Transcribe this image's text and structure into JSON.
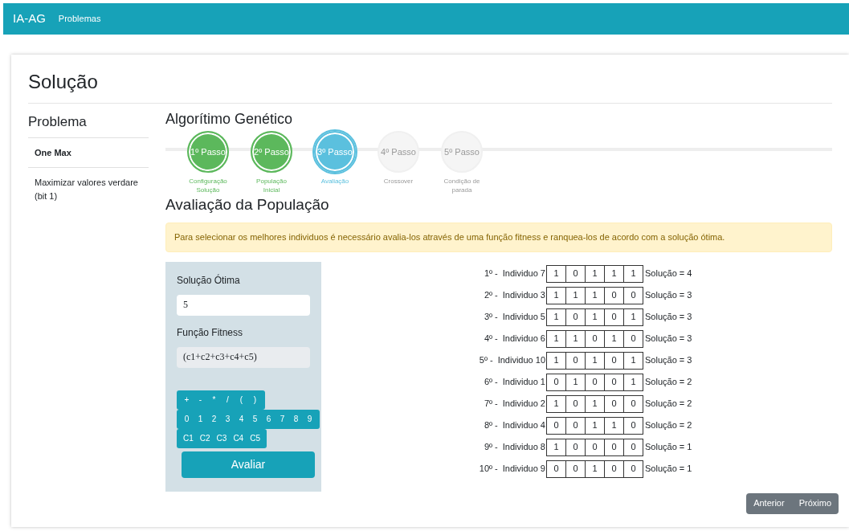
{
  "navbar": {
    "brand": "IA-AG",
    "links": [
      "Problemas"
    ]
  },
  "page_title": "Solução",
  "sidebar": {
    "title": "Problema",
    "items": [
      {
        "label": "One Max",
        "selected": true
      },
      {
        "label": "Maximizar valores verdare (bit 1)",
        "selected": false
      }
    ]
  },
  "section_title": "Algorítimo Genético",
  "steps": [
    {
      "label": "1º Passo",
      "caption": "Configuração Solução",
      "completed": true,
      "selected": false
    },
    {
      "label": "2º Passo",
      "caption": "População Inicial",
      "completed": true,
      "selected": false
    },
    {
      "label": "3º Passo",
      "caption": "Avaliação",
      "completed": false,
      "selected": true
    },
    {
      "label": "4º Passo",
      "caption": "Crossover",
      "completed": false,
      "selected": false
    },
    {
      "label": "5º Passo",
      "caption": "Condição de parada",
      "completed": false,
      "selected": false
    }
  ],
  "subtitle": "Avaliação da População",
  "alert": "Para selecionar os melhores individuos é necessário avalia-los através de uma função fitness e ranquea-los de acordo com a solução ótima.",
  "form": {
    "optimal_label": "Solução Ótima",
    "optimal_value": "5",
    "fitness_label": "Função Fitness",
    "fitness_value": "(c1+c2+c3+c4+c5)",
    "keypad": [
      [
        "+",
        "-",
        "*",
        "/",
        "(",
        ")"
      ],
      [
        "0",
        "1",
        "2",
        "3",
        "4",
        "5",
        "6",
        "7",
        "8",
        "9"
      ],
      [
        "C1",
        "C2",
        "C3",
        "C4",
        "C5"
      ]
    ],
    "submit": "Avaliar"
  },
  "ranking": [
    {
      "rank": "1º -",
      "name": "Individuo 7",
      "genes": [
        "1",
        "0",
        "1",
        "1",
        "1"
      ],
      "result": "Solução = 4"
    },
    {
      "rank": "2º -",
      "name": "Individuo 3",
      "genes": [
        "1",
        "1",
        "1",
        "0",
        "0"
      ],
      "result": "Solução = 3"
    },
    {
      "rank": "3º -",
      "name": "Individuo 5",
      "genes": [
        "1",
        "0",
        "1",
        "0",
        "1"
      ],
      "result": "Solução = 3"
    },
    {
      "rank": "4º -",
      "name": "Individuo 6",
      "genes": [
        "1",
        "1",
        "0",
        "1",
        "0"
      ],
      "result": "Solução = 3"
    },
    {
      "rank": "5º -",
      "name": "Individuo 10",
      "genes": [
        "1",
        "0",
        "1",
        "0",
        "1"
      ],
      "result": "Solução = 3"
    },
    {
      "rank": "6º -",
      "name": "Individuo 1",
      "genes": [
        "0",
        "1",
        "0",
        "0",
        "1"
      ],
      "result": "Solução = 2"
    },
    {
      "rank": "7º -",
      "name": "Individuo 2",
      "genes": [
        "1",
        "0",
        "1",
        "0",
        "0"
      ],
      "result": "Solução = 2"
    },
    {
      "rank": "8º -",
      "name": "Individuo 4",
      "genes": [
        "0",
        "0",
        "1",
        "1",
        "0"
      ],
      "result": "Solução = 2"
    },
    {
      "rank": "9º -",
      "name": "Individuo 8",
      "genes": [
        "1",
        "0",
        "0",
        "0",
        "0"
      ],
      "result": "Solução = 1"
    },
    {
      "rank": "10º -",
      "name": "Individuo 9",
      "genes": [
        "0",
        "0",
        "1",
        "0",
        "0"
      ],
      "result": "Solução = 1"
    }
  ],
  "pager": [
    "Anterior",
    "Próximo"
  ]
}
